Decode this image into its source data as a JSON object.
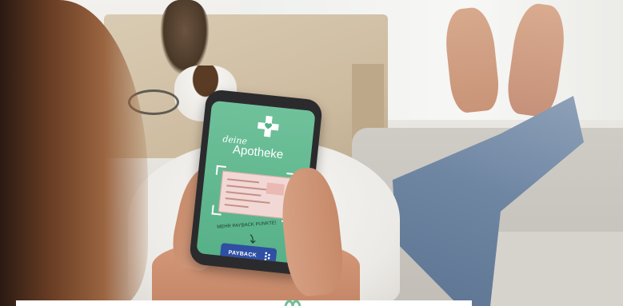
{
  "scene": {
    "description_alt": "Photo of a person holding a smartphone showing a pharmacy app",
    "colors": {
      "screen_green": "#5fb68f",
      "payback_blue": "#2f4fa3",
      "phone_body": "#2b2b2d"
    }
  },
  "phone_screen": {
    "brand_prefix": "deine",
    "brand_name": "Apotheke",
    "promo_text": "MEHR PAYBACK PUNKTE!",
    "payback_label": "PAYBACK",
    "logo_icon": "cross-heart-icon",
    "scan_icon": "scan-frame-icon",
    "arrow_icon": "arrow-down-icon"
  }
}
